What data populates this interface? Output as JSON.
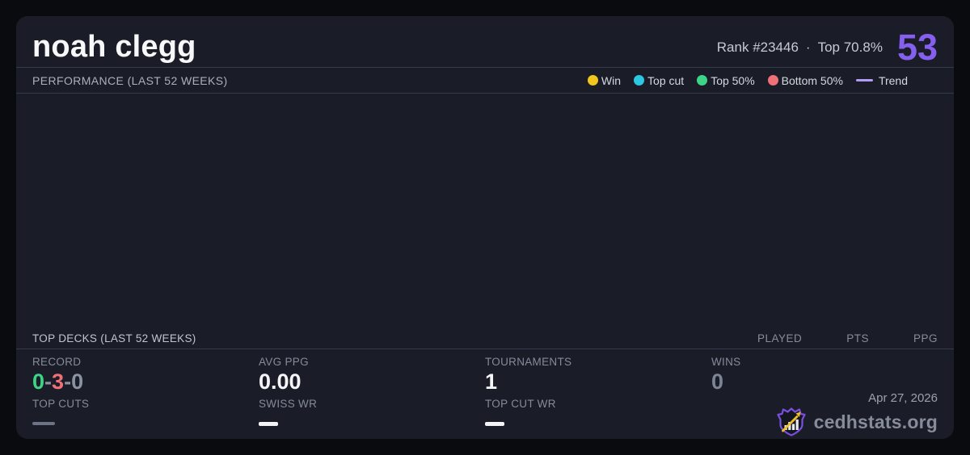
{
  "header": {
    "title": "noah clegg",
    "rank": "Rank #23446",
    "separator": "·",
    "top_percent": "Top 70.8%",
    "score": "53"
  },
  "colors": {
    "accent_purple": "#8560ee",
    "card_background": "#1a1d28",
    "page_background": "#0a0b0f",
    "divider": "#333a4c"
  },
  "performance": {
    "title": "PERFORMANCE (LAST 52 WEEKS)",
    "chart_empty": true,
    "legend": [
      {
        "label": "Win",
        "color": "#f2c71d",
        "type": "dot"
      },
      {
        "label": "Top cut",
        "color": "#2cc7e2",
        "type": "dot"
      },
      {
        "label": "Top 50%",
        "color": "#3ed488",
        "type": "dot"
      },
      {
        "label": "Bottom 50%",
        "color": "#f07078",
        "type": "dot"
      },
      {
        "label": "Trend",
        "color": "#b49bf5",
        "type": "line"
      }
    ]
  },
  "top_decks": {
    "title": "TOP DECKS (LAST 52 WEEKS)",
    "columns": [
      "PLAYED",
      "PTS",
      "PPG"
    ],
    "rows": []
  },
  "stats": {
    "record": {
      "label": "RECORD",
      "wins": "0",
      "losses": "3",
      "draws": "0",
      "separator": "-",
      "win_color": "#3ed488",
      "loss_color": "#f07078",
      "draw_color": "#8b92a2"
    },
    "avg_ppg": {
      "label": "AVG PPG",
      "value": "0.00"
    },
    "tournaments": {
      "label": "TOURNAMENTS",
      "value": "1"
    },
    "wins": {
      "label": "WINS",
      "value": "0",
      "value_color": "#7d8595"
    },
    "top_cuts": {
      "label": "TOP CUTS",
      "value": ""
    },
    "swiss_wr": {
      "label": "SWISS WR",
      "value": ""
    },
    "top_cut_wr": {
      "label": "TOP CUT WR",
      "value": ""
    }
  },
  "footer": {
    "date": "Apr 27, 2026",
    "brand": "cedhstats.org",
    "brand_icon": "crown-barchart-arrow-logo"
  }
}
